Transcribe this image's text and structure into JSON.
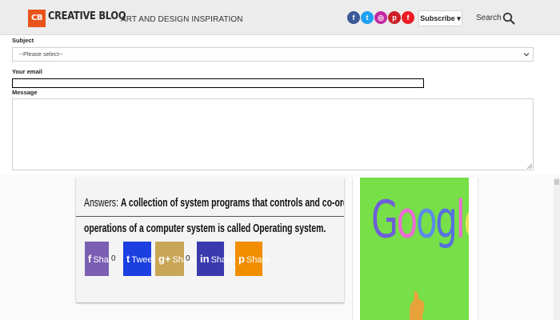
{
  "header": {
    "logo_badge": "CB",
    "logo_name": "CREATIVE BLOQ",
    "tagline": "ART AND DESIGN INSPIRATION",
    "social_icons": [
      "facebook-icon",
      "twitter-icon",
      "instagram-icon",
      "pinterest-icon",
      "flipboard-icon"
    ],
    "subscribe_label": "Subscribe ▾",
    "search_label": "Search"
  },
  "form": {
    "subject_label": "Subject",
    "subject_value": "--Please select--",
    "email_label": "Your email",
    "email_value": "",
    "message_label": "Message",
    "message_value": ""
  },
  "article": {
    "answer_prefix": "Answers:",
    "answer_text_line1": "A collection of system programs that controls and co-ordinates the overall",
    "answer_text_line2": "operations of a computer system is called Operating system.",
    "share_buttons": [
      {
        "icon": "f",
        "label": "Share",
        "count": "0",
        "color": "#7b5fb3"
      },
      {
        "icon": "t",
        "label": "Tweet",
        "count": "",
        "color": "#1b3fe0"
      },
      {
        "icon": "g+",
        "label": "Share",
        "count": "0",
        "color": "#c9a657"
      },
      {
        "icon": "in",
        "label": "Share",
        "count": "",
        "color": "#3a3aae"
      },
      {
        "icon": "p",
        "label": "Share",
        "count": "",
        "color": "#f18f00"
      }
    ]
  },
  "ad": {
    "word": "Google",
    "background": "#77df47"
  }
}
